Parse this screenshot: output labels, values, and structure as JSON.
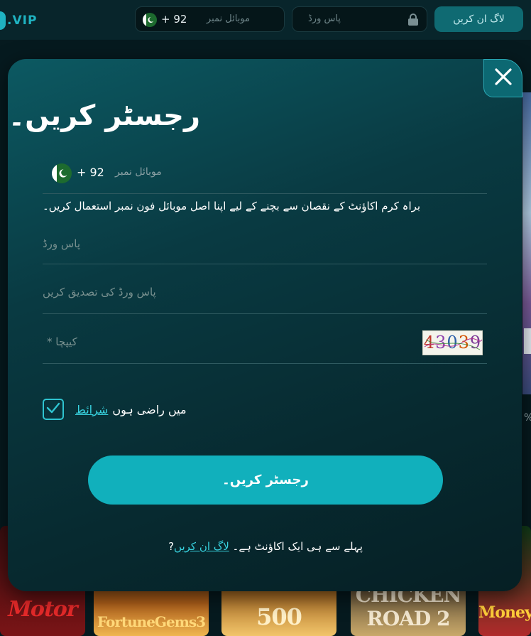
{
  "background": {
    "logo_text": ".VIP",
    "phone": {
      "code": "+ 92",
      "placeholder": "موبائل نمبر"
    },
    "password": {
      "placeholder": "پاس ورڈ"
    },
    "login_button": "لاگ ان کریں",
    "side_text": "%",
    "games": [
      {
        "name": "Motor"
      },
      {
        "name": "FortuneGems3"
      },
      {
        "name": "500"
      },
      {
        "name": "CHICKEN ROAD 2"
      },
      {
        "name": "Money"
      }
    ]
  },
  "modal": {
    "title": "رجسٹر کریں۔",
    "phone": {
      "code": "+ 92",
      "label": "موبائل نمبر"
    },
    "hint": "براہ کرم اکاؤنٹ کے نقصان سے بچنے کے لیے اپنا اصل موبائل فون نمبر استعمال کریں۔",
    "password": {
      "placeholder": "پاس ورڈ"
    },
    "confirm_password": {
      "placeholder": "پاس ورڈ کی تصدیق کریں"
    },
    "captcha": {
      "placeholder": "* کیپچا",
      "code": "43039"
    },
    "agree": {
      "checked": true,
      "text": "میں راضی ہوں",
      "terms_link": "شرائط"
    },
    "register_button": "رجسٹر کریں۔",
    "footer": {
      "login_link": "لاگ ان کریں",
      "text": "?پہلے سے ہی ایک اکاؤنٹ ہے۔"
    }
  },
  "colors": {
    "accent": "#11b0bc",
    "link": "#38d3e0",
    "modal_bg": "#093a42",
    "page_bg": "#061a1f"
  }
}
